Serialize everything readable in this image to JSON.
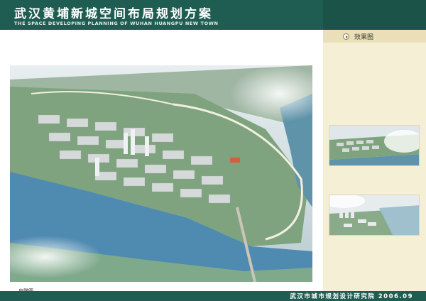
{
  "header": {
    "title": "武汉黄埔新城空间布局规划方案",
    "subtitle": "THE SPACE DEVELOPING PLANNING OF WUHAN HUANGPU NEW TOWN"
  },
  "main": {
    "caption": "鸟瞰图"
  },
  "side_panel": {
    "title": "效果图",
    "bullet_icon": "play-bullet-icon"
  },
  "footer": {
    "text": "武汉市城市规划设计研究院 2006.09"
  },
  "colors": {
    "brand_green": "#1f5d52",
    "panel_beige": "#f5efd6"
  }
}
